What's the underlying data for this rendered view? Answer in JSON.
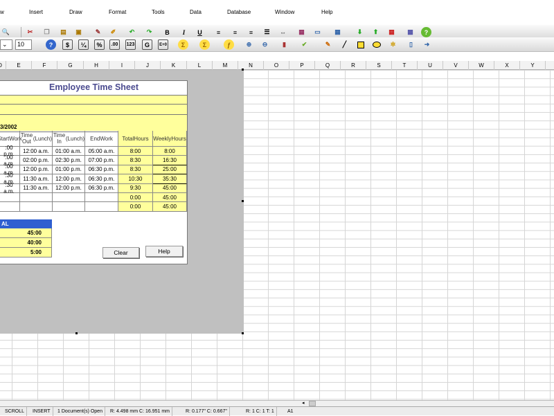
{
  "menu": {
    "view": "w",
    "insert": "Insert",
    "draw": "Draw",
    "format": "Format",
    "tools": "Tools",
    "data": "Data",
    "database": "Database",
    "window": "Window",
    "help": "Help"
  },
  "toolbar": {
    "bold": "B",
    "italic": "I",
    "underline": "U",
    "font_size": "10",
    "currency": "$",
    "fraction": "¼",
    "percent": "%",
    "decimals": ".00",
    "number": "123",
    "general": "G",
    "scientific": "E+0"
  },
  "columns": [
    "D",
    "E",
    "F",
    "G",
    "H",
    "I",
    "J",
    "K",
    "L",
    "M",
    "N",
    "O",
    "P",
    "Q",
    "R",
    "S",
    "T",
    "U",
    "V",
    "W",
    "X",
    "Y"
  ],
  "sheet": {
    "title": "Employee Time Sheet",
    "date": "3/2002",
    "headers": [
      [
        "Start",
        "Work"
      ],
      [
        "Time Out",
        "(Lunch)"
      ],
      [
        "Time In",
        "(Lunch)"
      ],
      [
        "End",
        "Work"
      ],
      [
        "Total",
        "Hours"
      ],
      [
        "Weekly",
        "Hours"
      ]
    ],
    "rows": [
      [
        ":00 p.m.",
        "12:00 a.m.",
        "01:00 a.m.",
        "05:00 a.m.",
        "8:00",
        "8:00"
      ],
      [
        ":00 a.m.",
        "02:00 p.m.",
        "02:30 p.m.",
        "07:00 p.m.",
        "8:30",
        "16:30"
      ],
      [
        ":00 a.m.",
        "12:00 p.m.",
        "01:00 p.m.",
        "06:30 p.m.",
        "8:30",
        "25:00"
      ],
      [
        ":30 a.m.",
        "11:30 a.m.",
        "12:00 p.m.",
        "06:30 p.m.",
        "10:30",
        "35:30"
      ],
      [
        ":30 a.m.",
        "11:30 a.m.",
        "12:00 p.m.",
        "06:30 p.m.",
        "9:30",
        "45:00"
      ],
      [
        "",
        "",
        "",
        "",
        "0:00",
        "45:00"
      ],
      [
        "",
        "",
        "",
        "",
        "0:00",
        "45:00"
      ]
    ],
    "total_label": "AL",
    "totals": [
      "45:00",
      "40:00",
      "5:00"
    ],
    "clear": "Clear",
    "help": "Help"
  },
  "status": {
    "scroll": "SCROLL",
    "insert": "INSERT",
    "docs": "1 Document(s) Open",
    "pos1": "R: 4.498 mm   C: 16.951 mm",
    "pos2": "R: 0.177\"   C: 0.667\"",
    "pos3": "R: 1  C: 1  T: 1",
    "cell": "A1"
  }
}
